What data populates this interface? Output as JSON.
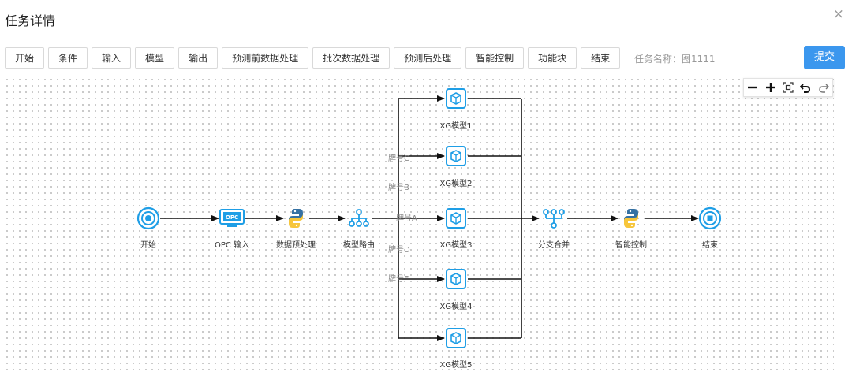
{
  "header": {
    "title": "任务详情",
    "close_glyph": "×"
  },
  "toolbar": {
    "buttons": [
      "开始",
      "条件",
      "输入",
      "模型",
      "输出",
      "预测前数据处理",
      "批次数据处理",
      "预测后处理",
      "智能控制",
      "功能块",
      "结束"
    ],
    "task_name": "任务名称：图1111",
    "submit_label": "提交"
  },
  "zoom_controls": [
    "zoom-out",
    "zoom-in",
    "fit-view",
    "undo",
    "redo"
  ],
  "flow": {
    "nodes": {
      "start": "开始",
      "opc_input": "OPC 输入",
      "preprocess": "数据预处理",
      "router": "模型路由",
      "model1": "XG模型1",
      "model2": "XG模型2",
      "model3": "XG模型3",
      "model4": "XG模型4",
      "model5": "XG模型5",
      "merge": "分支合并",
      "control": "智能控制",
      "end": "结束"
    },
    "branch_labels": {
      "c": "牌号C",
      "b": "牌号B",
      "a": "牌号A",
      "d": "牌号D",
      "e": "牌号E"
    },
    "opc_badge": "OPC"
  },
  "colors": {
    "accent": "#3b97ee",
    "node_icon": "#1e9ee6",
    "python_blue": "#3571a3",
    "python_yellow": "#f7c63b",
    "edge": "#111111"
  }
}
